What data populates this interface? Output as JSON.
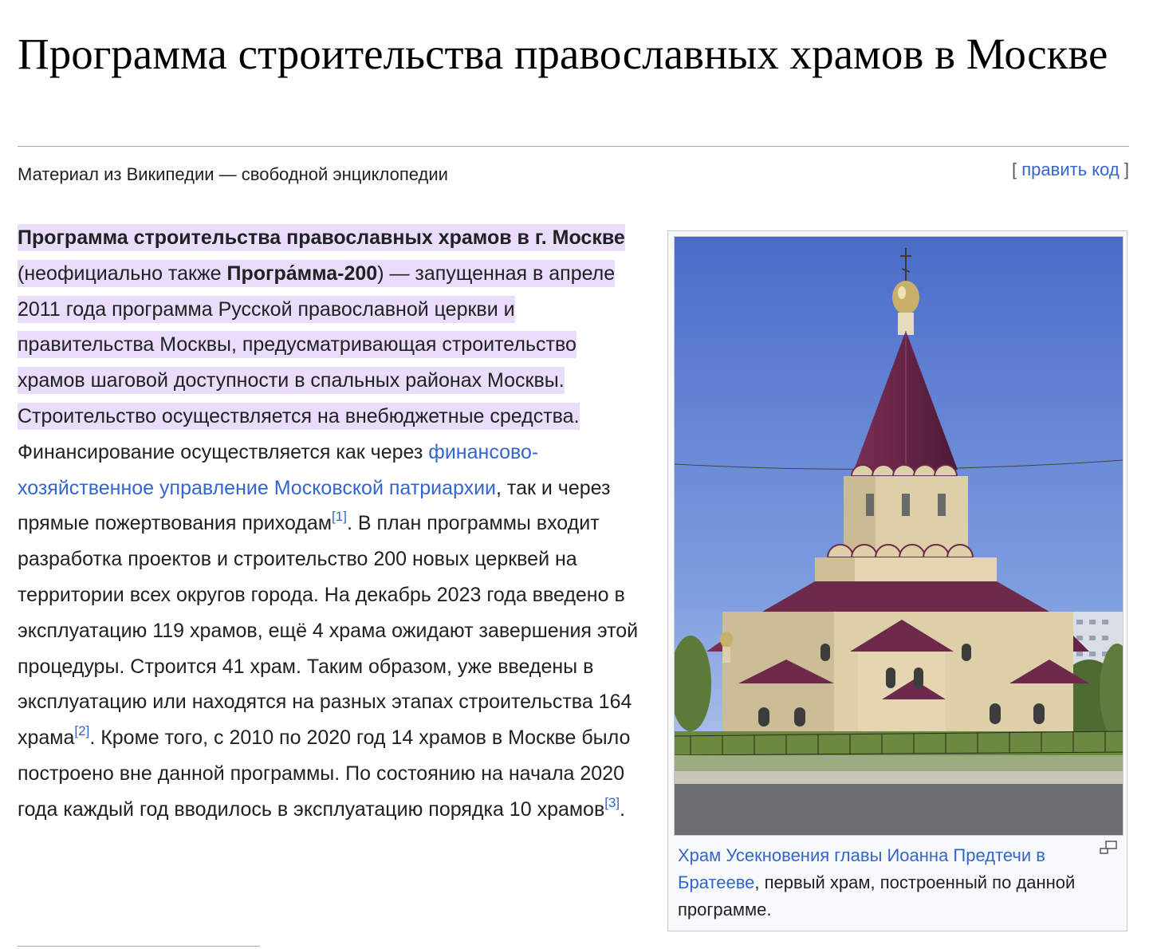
{
  "page": {
    "title": "Программа строительства православных храмов в Москве",
    "tagline": "Материал из Википедии — свободной энциклопедии",
    "edit": {
      "open": "[",
      "label": "править код",
      "close": "]"
    }
  },
  "lead": {
    "b1": "Программа строительства православных храмов в г. Москве",
    "t1": " (неофициально также ",
    "b2": "Програ́мма-200",
    "t2": ") — запущенная в апреле 2011 года программа Русской православной церкви и правительства Москвы, предусматривающая строительство храмов шаговой доступности в спальных районах Москвы. Строительство осуществляется на внебюджетные средства.",
    "t3": " Финансирование осуществляется как через ",
    "link1": "финансово-хозяйственное управление Московской патриархии",
    "t4": ", так и через прямые пожертвования приходам",
    "ref1": "[1]",
    "t5": ". В план программы входит разработка проектов и строительство 200 новых церквей на территории всех округов города. На декабрь 2023 года введено в эксплуатацию 119 храмов, ещё 4 храма ожидают завершения этой процедуры. Строится 41 храм. Таким образом, уже введены в эксплуатацию или находятся на разных этапах строительства 164 храма",
    "ref2": "[2]",
    "t6": ". Кроме того, с 2010 по 2020 год 14 храмов в Москве было построено вне данной программы. По состоянию на начала 2020 года каждый год вводилось в эксплуатацию порядка 10 храмов",
    "ref3": "[3]",
    "t7": "."
  },
  "figure": {
    "caption_link": "Храм Усекновения главы Иоанна Предтечи в Братееве",
    "caption_text": ", первый храм, построенный по данной программе.",
    "enlarge_icon": "magnify-clip-icon"
  },
  "colors": {
    "link": "#3366cc",
    "highlight": "#eadcfb",
    "sky": "#5d7fd0",
    "roof": "#6e2a4a",
    "wall": "#ddcfa8"
  }
}
